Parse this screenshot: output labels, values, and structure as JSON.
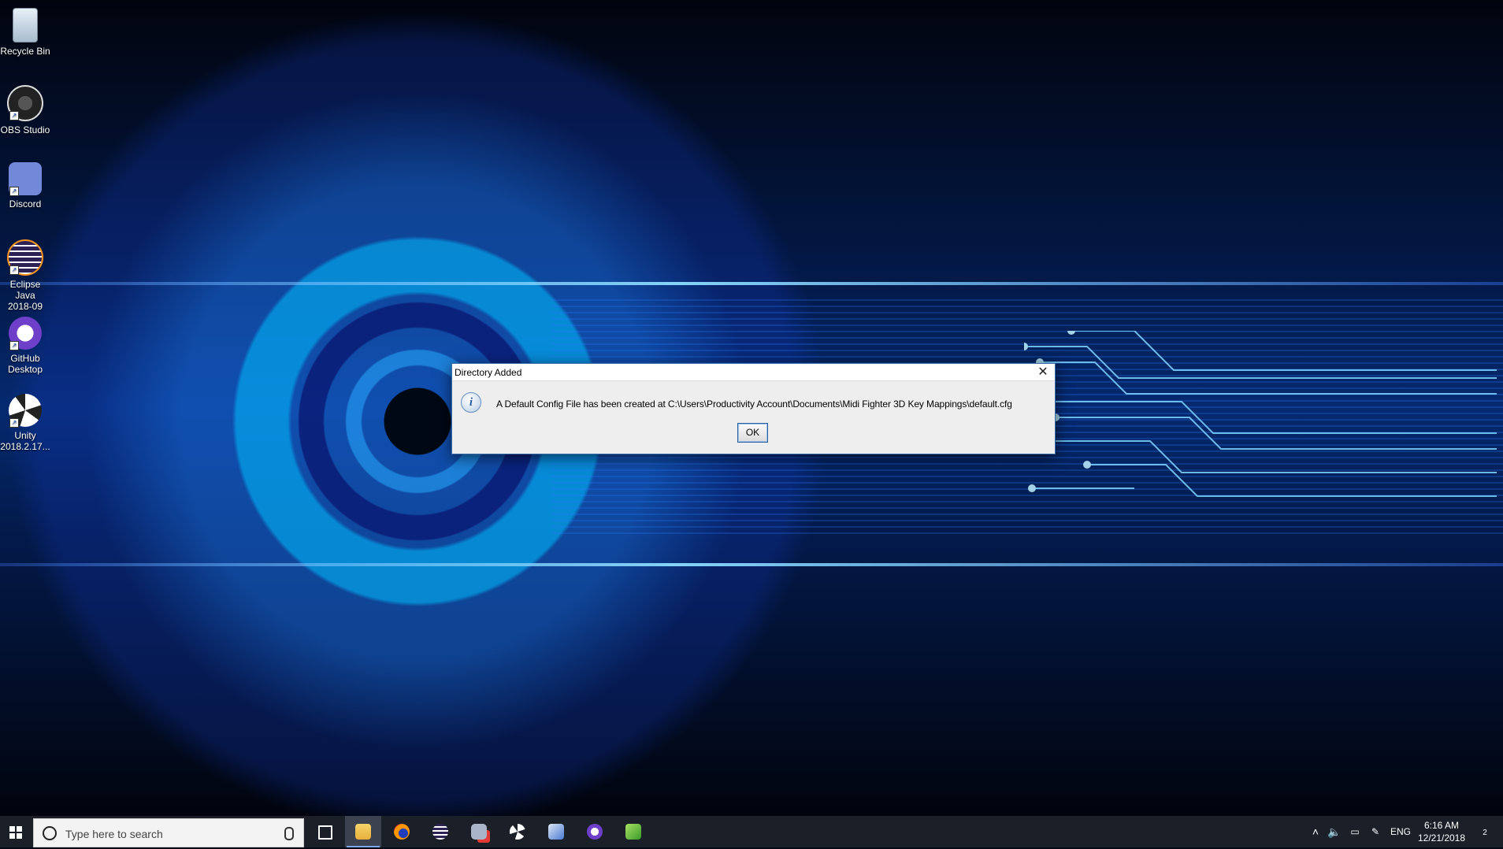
{
  "desktop_icons": [
    {
      "label": "Recycle Bin",
      "icon": "recycle-bin-icon"
    },
    {
      "label": "OBS Studio",
      "icon": "obs-studio-icon"
    },
    {
      "label": "Discord",
      "icon": "discord-icon"
    },
    {
      "label": "Eclipse Java\n2018-09",
      "icon": "eclipse-icon"
    },
    {
      "label": "GitHub\nDesktop",
      "icon": "github-desktop-icon"
    },
    {
      "label": "Unity\n2018.2.17...",
      "icon": "unity-icon"
    }
  ],
  "dialog": {
    "title": "Directory Added",
    "close_glyph": "✕",
    "info_glyph": "i",
    "message": "A Default Config File has been created at C:\\Users\\Productivity Account\\Documents\\Midi Fighter 3D Key Mappings\\default.cfg",
    "ok_label": "OK"
  },
  "taskbar": {
    "search_placeholder": "Type here to search",
    "pinned": [
      {
        "name": "task-view",
        "icon": "task-view-icon"
      },
      {
        "name": "file-explorer",
        "icon": "folder-icon",
        "active": true
      },
      {
        "name": "firefox",
        "icon": "firefox-icon"
      },
      {
        "name": "eclipse",
        "icon": "eclipse-icon"
      },
      {
        "name": "obs-studio",
        "icon": "obs-icon"
      },
      {
        "name": "unity",
        "icon": "unity-icon"
      },
      {
        "name": "app-6",
        "icon": "paint-icon"
      },
      {
        "name": "github-desktop",
        "icon": "github-icon"
      },
      {
        "name": "app-8",
        "icon": "notepad-icon"
      }
    ],
    "tray": {
      "language": "ENG",
      "time": "6:16 AM",
      "date": "12/21/2018",
      "notification_count": "2"
    }
  },
  "colors": {
    "accent": "#3b6ea8",
    "taskbar_bg": "#1b1f28"
  }
}
